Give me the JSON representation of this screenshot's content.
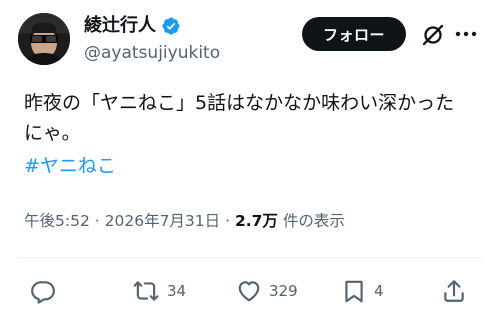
{
  "user": {
    "display_name": "綾辻行人",
    "handle": "@ayatsujiyukito",
    "verified": true
  },
  "header": {
    "follow_label": "フォロー",
    "grok_icon": "grok-icon",
    "more_icon": "more-icon"
  },
  "tweet": {
    "text": "昨夜の「ヤニねこ」5話はなかなか味わい深かったにゃ。",
    "hashtag": "#ヤニねこ"
  },
  "meta": {
    "time": "午後5:52",
    "separator": "·",
    "date": "2026年7月31日",
    "views_count": "2.7万",
    "views_label": "件の表示"
  },
  "actions": {
    "reply_count": "",
    "retweet_count": "34",
    "like_count": "329",
    "bookmark_count": "4"
  },
  "colors": {
    "text": "#0f1419",
    "secondary": "#536471",
    "accent": "#1d9bf0",
    "verified": "#1d9bf0",
    "follow_bg": "#0f1419"
  }
}
